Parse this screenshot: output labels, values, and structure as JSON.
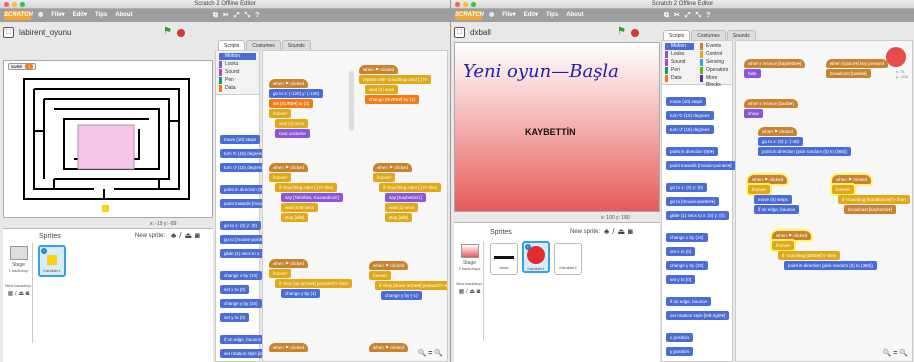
{
  "app": {
    "title": "Scratch 2 Offline Editor",
    "logo": "SCRATCH",
    "menus": [
      "File▾",
      "Edit▾",
      "Tips",
      "About"
    ],
    "tool_icons": [
      "duplicate-icon",
      "cut-icon",
      "grow-icon",
      "shrink-icon",
      "help-icon"
    ]
  },
  "left": {
    "project_name": "labirent_oyunu",
    "version_label": "v458.0.1",
    "stage": {
      "variable_label": "SURE",
      "variable_value": "1"
    },
    "coords": "x: -19  y: -89",
    "sprites_label": "Sprites",
    "new_sprite_label": "New sprite:",
    "stage_label": "Stage",
    "stage_sub": "1 backdrop",
    "new_backdrop_label": "New backdrop:",
    "sprites": [
      {
        "name": "Karakter1"
      }
    ],
    "tabs": [
      "Scripts",
      "Costumes",
      "Sounds"
    ],
    "categories": [
      [
        "Motion",
        "Events"
      ],
      [
        "Looks",
        "Control"
      ],
      [
        "Sound",
        "Sensing"
      ],
      [
        "Pen",
        "Operators"
      ],
      [
        "Data",
        "More Blocks"
      ]
    ],
    "palette": [
      "move (10) steps",
      "turn ↻ (15) degrees",
      "turn ↺ (15) degrees",
      "point in direction (90▾)",
      "point towards [mouse-pointer▾]",
      "go to x: (0) y: (0)",
      "go to [mouse-pointer▾]",
      "glide (1) secs to x: (0) y: (0)",
      "change x by (10)",
      "set x to (0)",
      "change y by (10)",
      "set y to (0)",
      "if on edge, bounce",
      "set rotation style [left-right▾]",
      "x position",
      "y position"
    ],
    "scripts": [
      {
        "blocks": [
          "when ⚑ clicked",
          "go to x: (-120) y: (-130)",
          "set [SURE▾] to (0)",
          "forever",
          "wait (1) secs",
          "next costume"
        ]
      },
      {
        "blocks": [
          "when ⚑ clicked",
          "repeat until <touching color [ ]?>",
          "wait (1) secs",
          "change [SURE▾] by (1)"
        ]
      },
      {
        "blocks": [
          "when ⚑ clicked",
          "forever",
          "if <touching color [ ]?> then",
          "say [Tebrikler, Kazandınız!]",
          "wait (0.5) secs",
          "stop [all▾]"
        ]
      },
      {
        "blocks": [
          "when ⚑ clicked",
          "forever",
          "if <touching color [ ]?> then",
          "say [Kaybettiniz]",
          "wait (1) secs",
          "stop [all▾]"
        ]
      },
      {
        "blocks": [
          "when ⚑ clicked",
          "forever",
          "if <key [up arrow▾] pressed?> then",
          "change y by (1)"
        ]
      },
      {
        "blocks": [
          "when ⚑ clicked",
          "forever",
          "if <key [down arrow▾] pressed?> then",
          "change y by (-1)"
        ]
      },
      {
        "blocks": [
          "when ⚑ clicked"
        ]
      },
      {
        "blocks": [
          "when ⚑ clicked"
        ]
      }
    ]
  },
  "right": {
    "project_name": "dxball",
    "stage": {
      "handwriting": "Yeni oyun—Başla",
      "lose_text": "KAYBETTİN"
    },
    "coords": "x: 190  y: 180",
    "sprites_label": "Sprites",
    "new_sprite_label": "New sprite:",
    "stage_label": "Stage",
    "stage_sub": "2 backdrops",
    "new_backdrop_label": "New backdrop:",
    "sprites": [
      {
        "name": "tahta"
      },
      {
        "name": "Karakter1"
      },
      {
        "name": "Karakter2"
      }
    ],
    "tabs": [
      "Scripts",
      "Costumes",
      "Sounds"
    ],
    "categories": [
      [
        "Motion",
        "Events"
      ],
      [
        "Looks",
        "Control"
      ],
      [
        "Sound",
        "Sensing"
      ],
      [
        "Pen",
        "Operators"
      ],
      [
        "Data",
        "More Blocks"
      ]
    ],
    "palette": [
      "move (10) steps",
      "turn ↻ (15) degrees",
      "turn ↺ (15) degrees",
      "point in direction (90▾)",
      "point towards [mouse-pointer▾]",
      "go to x: (0) y: (0)",
      "go to [mouse-pointer▾]",
      "glide (1) secs to x: (0) y: (0)",
      "change x by (10)",
      "set x to (0)",
      "change y by (10)",
      "set y to (0)",
      "if on edge, bounce",
      "set rotation style [left-right▾]",
      "x position",
      "y position"
    ],
    "sprite_xy": "x: 75\ny: -104",
    "scripts": [
      {
        "blocks": [
          "when I receive [kaybettin▾]",
          "hide"
        ]
      },
      {
        "blocks": [
          "when [space▾] key pressed",
          "broadcast [basla▾]"
        ]
      },
      {
        "blocks": [
          "when I receive [basla▾]",
          "show"
        ]
      },
      {
        "blocks": [
          "when ⚑ clicked",
          "go to x: (0) y: (-40)",
          "point in direction (pick random (0) to (360))"
        ]
      },
      {
        "blocks": [
          "when ⚑ clicked",
          "forever",
          "move (5) steps",
          "if on edge, bounce"
        ]
      },
      {
        "blocks": [
          "when ⚑ clicked",
          "forever",
          "if <touching [Karakter1▾]?> then",
          "broadcast [kaybettin▾]"
        ]
      },
      {
        "blocks": [
          "when ⚑ clicked",
          "forever",
          "if <touching [tahta▾]?> then",
          "point in direction (pick random (0) to (360))"
        ]
      }
    ]
  },
  "zoom_controls": "🔍 = 🔍"
}
